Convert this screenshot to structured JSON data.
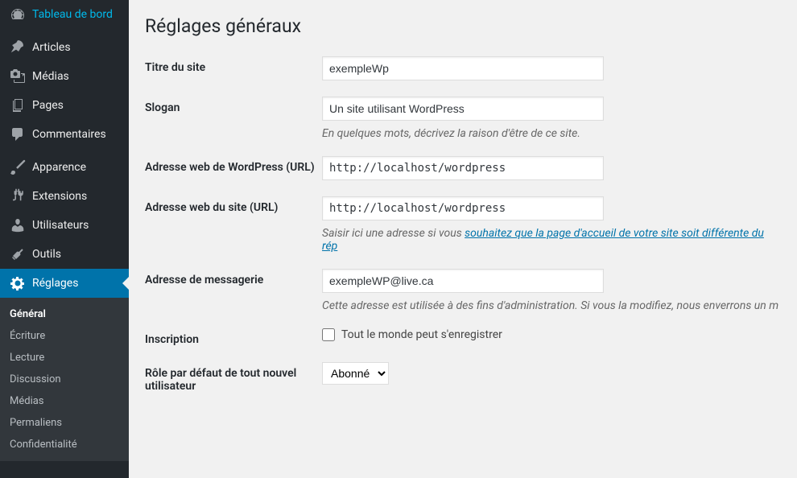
{
  "sidebar": {
    "items": [
      {
        "label": "Tableau de bord",
        "icon": "dashboard"
      },
      {
        "label": "Articles",
        "icon": "pin"
      },
      {
        "label": "Médias",
        "icon": "media"
      },
      {
        "label": "Pages",
        "icon": "page"
      },
      {
        "label": "Commentaires",
        "icon": "comment"
      },
      {
        "label": "Apparence",
        "icon": "brush"
      },
      {
        "label": "Extensions",
        "icon": "plugin"
      },
      {
        "label": "Utilisateurs",
        "icon": "user"
      },
      {
        "label": "Outils",
        "icon": "tools"
      },
      {
        "label": "Réglages",
        "icon": "settings"
      }
    ],
    "submenu": [
      {
        "label": "Général"
      },
      {
        "label": "Écriture"
      },
      {
        "label": "Lecture"
      },
      {
        "label": "Discussion"
      },
      {
        "label": "Médias"
      },
      {
        "label": "Permaliens"
      },
      {
        "label": "Confidentialité"
      }
    ]
  },
  "page": {
    "title": "Réglages généraux"
  },
  "form": {
    "site_title": {
      "label": "Titre du site",
      "value": "exempleWp"
    },
    "tagline": {
      "label": "Slogan",
      "value": "Un site utilisant WordPress",
      "help": "En quelques mots, décrivez la raison d'être de ce site."
    },
    "wp_url": {
      "label": "Adresse web de WordPress (URL)",
      "value": "http://localhost/wordpress"
    },
    "site_url": {
      "label": "Adresse web du site (URL)",
      "value": "http://localhost/wordpress",
      "help_prefix": "Saisir ici une adresse si vous ",
      "help_link": "souhaitez que la page d'accueil de votre site soit différente du rép"
    },
    "email": {
      "label": "Adresse de messagerie",
      "value": "exempleWP@live.ca",
      "help": "Cette adresse est utilisée à des fins d'administration. Si vous la modifiez, nous enverrons un m"
    },
    "registration": {
      "label": "Inscription",
      "checkbox_label": "Tout le monde peut s'enregistrer"
    },
    "default_role": {
      "label": "Rôle par défaut de tout nouvel utilisateur",
      "value": "Abonné"
    }
  }
}
